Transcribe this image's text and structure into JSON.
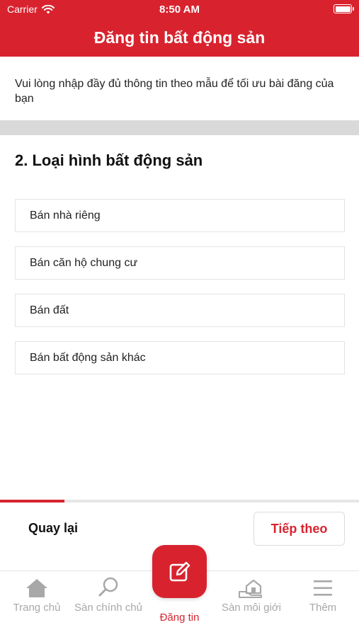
{
  "status_bar": {
    "carrier": "Carrier",
    "time": "8:50 AM"
  },
  "header": {
    "title": "Đăng tin bất động sản"
  },
  "intro_text": "Vui lòng nhập đầy đủ thông tin theo mẫu để tối ưu bài đăng của bạn",
  "section": {
    "title": "2. Loại hình bất động sản"
  },
  "options": [
    {
      "label": "Bán nhà riêng"
    },
    {
      "label": "Bán căn hộ chung cư"
    },
    {
      "label": "Bán đất"
    },
    {
      "label": "Bán bất động sản khác"
    }
  ],
  "progress": {
    "fraction": 0.18
  },
  "footer": {
    "back_label": "Quay lại",
    "next_label": "Tiếp theo"
  },
  "tabbar": {
    "tabs": [
      {
        "label": "Trang chủ",
        "icon": "home-icon"
      },
      {
        "label": "Sàn chính chủ",
        "icon": "search-icon"
      },
      {
        "label": "Đăng tin",
        "icon": "edit-icon"
      },
      {
        "label": "Sàn môi giới",
        "icon": "broker-icon"
      },
      {
        "label": "Thêm",
        "icon": "menu-icon"
      }
    ]
  },
  "colors": {
    "accent": "#d8232f",
    "inactive": "#a8a8a8",
    "band": "#d9d9d9"
  }
}
